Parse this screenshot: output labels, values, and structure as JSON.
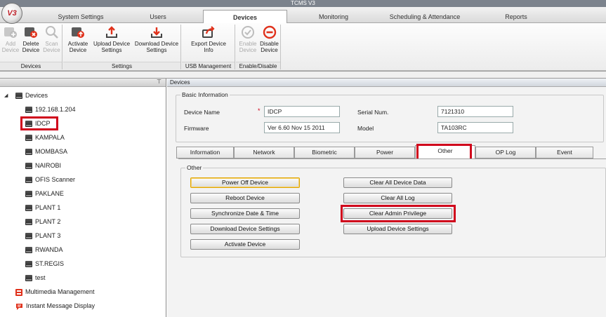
{
  "app": {
    "title": "TCMS V3",
    "logo_text": "V3"
  },
  "menu": {
    "tabs": [
      {
        "label": "System Settings"
      },
      {
        "label": "Users"
      },
      {
        "label": "Devices"
      },
      {
        "label": "Monitoring"
      },
      {
        "label": "Scheduling & Attendance"
      },
      {
        "label": "Reports"
      }
    ],
    "active": "Devices"
  },
  "ribbon": {
    "groups": [
      {
        "label": "Devices",
        "buttons": [
          {
            "line1": "Add",
            "line2": "Device",
            "enabled": false,
            "icon": "add-device-icon"
          },
          {
            "line1": "Delete",
            "line2": "Device",
            "enabled": true,
            "icon": "delete-device-icon"
          },
          {
            "line1": "Scan",
            "line2": "Device",
            "enabled": false,
            "icon": "scan-device-icon"
          }
        ]
      },
      {
        "label": "Settings",
        "buttons": [
          {
            "line1": "Activate",
            "line2": "Device",
            "enabled": true,
            "icon": "activate-device-icon"
          },
          {
            "line1": "Upload Device",
            "line2": "Settings",
            "enabled": true,
            "icon": "upload-icon"
          },
          {
            "line1": "Download Device",
            "line2": "Settings",
            "enabled": true,
            "icon": "download-icon"
          }
        ]
      },
      {
        "label": "USB Management",
        "buttons": [
          {
            "line1": "Export Device",
            "line2": "Info",
            "enabled": true,
            "icon": "export-icon"
          }
        ]
      },
      {
        "label": "Enable/Disable",
        "buttons": [
          {
            "line1": "Enable",
            "line2": "Device",
            "enabled": false,
            "icon": "enable-check-icon"
          },
          {
            "line1": "Disable",
            "line2": "Device",
            "enabled": true,
            "icon": "disable-minus-icon"
          }
        ]
      }
    ]
  },
  "left_panel": {
    "pin": "⊤",
    "tree": {
      "root": "Devices",
      "devices": [
        "192.168.1.204",
        "IDCP",
        "KAMPALA",
        "MOMBASA",
        "NAIROBI",
        "OFIS Scanner",
        "PAKLANE",
        "PLANT 1",
        "PLANT 2",
        "PLANT 3",
        "RWANDA",
        "ST.REGIS",
        "test"
      ],
      "selected": "IDCP",
      "extra": [
        "Multimedia Management",
        "Instant Message Display"
      ]
    }
  },
  "right_panel": {
    "header": "Devices",
    "basic_info": {
      "legend": "Basic Information",
      "device_name_label": "Device Name",
      "required_mark": "*",
      "device_name_value": "IDCP",
      "serial_label": "Serial Num.",
      "serial_value": "7121310",
      "firmware_label": "Firmware",
      "firmware_value": "Ver 6.60 Nov 15 2011",
      "model_label": "Model",
      "model_value": "TA103RC"
    },
    "tabs": [
      "Information",
      "Network",
      "Biometric",
      "Power",
      "Other",
      "OP Log",
      "Event"
    ],
    "active_tab": "Other",
    "other": {
      "legend": "Other",
      "left_buttons": [
        "Power Off Device",
        "Reboot Device",
        "Synchronize Date & Time",
        "Download Device Settings",
        "Activate Device"
      ],
      "right_buttons": [
        "Clear All Device Data",
        "Clear All Log",
        "Clear Admin Privilege",
        "Upload Device Settings"
      ]
    }
  },
  "colors": {
    "highlight": "#d0021b",
    "title_bar": "#7c838d"
  }
}
